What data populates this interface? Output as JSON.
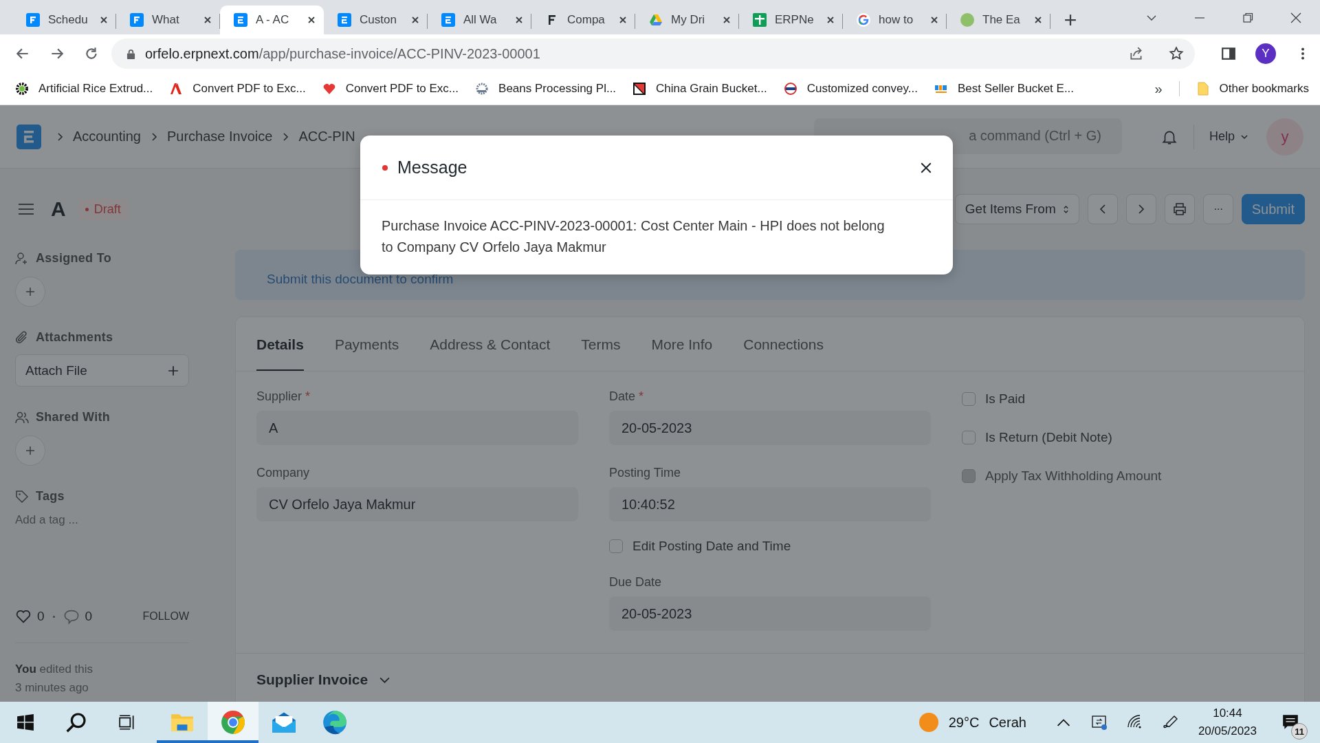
{
  "browser": {
    "tabs": [
      {
        "title": "Schedu",
        "kind": "frappe",
        "selected": false
      },
      {
        "title": "What",
        "kind": "frappe",
        "selected": false
      },
      {
        "title": "A - AC",
        "kind": "erpnext",
        "selected": true
      },
      {
        "title": "Custon",
        "kind": "erpnext",
        "selected": false
      },
      {
        "title": "All Wa",
        "kind": "erpnext",
        "selected": false
      },
      {
        "title": "Compa",
        "kind": "frappe-dark",
        "selected": false
      },
      {
        "title": "My Dri",
        "kind": "drive",
        "selected": false
      },
      {
        "title": "ERPNe",
        "kind": "sheets",
        "selected": false
      },
      {
        "title": "how to",
        "kind": "google",
        "selected": false
      },
      {
        "title": "The Ea",
        "kind": "circle",
        "selected": false
      }
    ],
    "address": {
      "host": "orfelo.erpnext.com",
      "path": "/app/purchase-invoice/ACC-PINV-2023-00001"
    },
    "profile": "Y",
    "bookmarks": [
      {
        "label": "Artificial Rice Extrud...",
        "kind": "gear"
      },
      {
        "label": "Convert PDF to Exc...",
        "kind": "adobe"
      },
      {
        "label": "Convert PDF to Exc...",
        "kind": "heart"
      },
      {
        "label": "Beans Processing Pl...",
        "kind": "cog"
      },
      {
        "label": "China Grain Bucket...",
        "kind": "flag"
      },
      {
        "label": "Customized convey...",
        "kind": "seal"
      },
      {
        "label": "Best Seller Bucket E...",
        "kind": "hic"
      }
    ],
    "overflow": "»",
    "other_bookmarks": "Other bookmarks"
  },
  "navbar": {
    "breadcrumbs": [
      "Accounting",
      "Purchase Invoice",
      "ACC-PIN"
    ],
    "search_placeholder": "a command (Ctrl + G)",
    "help": "Help",
    "avatar": "y"
  },
  "page_head": {
    "title": "A",
    "status": "Draft",
    "menu_button": "Get Items From",
    "more": "···",
    "primary": "Submit"
  },
  "sidebar": {
    "assigned_to": "Assigned To",
    "attachments": "Attachments",
    "attach_file": "Attach File",
    "shared_with": "Shared With",
    "tags": "Tags",
    "add_tag": "Add a tag ...",
    "likes": "0",
    "comments": "0",
    "follow": "FOLLOW",
    "activity_actor": "You",
    "activity_text": "edited this",
    "activity_time": "3 minutes ago"
  },
  "banner": "Submit this document to confirm",
  "form_tabs": [
    {
      "label": "Details",
      "selected": true
    },
    {
      "label": "Payments",
      "selected": false
    },
    {
      "label": "Address & Contact",
      "selected": false
    },
    {
      "label": "Terms",
      "selected": false
    },
    {
      "label": "More Info",
      "selected": false
    },
    {
      "label": "Connections",
      "selected": false
    }
  ],
  "columns": [
    {
      "items": [
        {
          "kind": "field",
          "label": "Supplier",
          "required_mark": "*",
          "value": "A"
        },
        {
          "kind": "field",
          "label": "Company",
          "value": "CV Orfelo Jaya Makmur"
        }
      ]
    },
    {
      "items": [
        {
          "kind": "field",
          "label": "Date",
          "required_mark": "*",
          "value": "20-05-2023"
        },
        {
          "kind": "field",
          "label": "Posting Time",
          "value": "10:40:52"
        },
        {
          "kind": "check",
          "label": "Edit Posting Date and Time",
          "checked": false,
          "disabled": false
        },
        {
          "kind": "field",
          "label": "Due Date",
          "value": "20-05-2023"
        }
      ]
    },
    {
      "items": [
        {
          "kind": "check",
          "label": "Is Paid",
          "checked": false,
          "disabled": false
        },
        {
          "kind": "check",
          "label": "Is Return (Debit Note)",
          "checked": false,
          "disabled": false
        },
        {
          "kind": "check",
          "label": "Apply Tax Withholding Amount",
          "checked": false,
          "disabled": true
        }
      ]
    }
  ],
  "section": "Supplier Invoice",
  "modal": {
    "title": "Message",
    "text": "Purchase Invoice ACC-PINV-2023-00001: Cost Center Main - HPI does not belong to Company CV Orfelo Jaya Makmur"
  },
  "taskbar": {
    "apps": [
      {
        "kind": "start",
        "running": false,
        "selected": false
      },
      {
        "kind": "search",
        "running": false,
        "selected": false
      },
      {
        "kind": "taskview",
        "running": false,
        "selected": false
      },
      {
        "kind": "explorer",
        "running": true,
        "selected": false
      },
      {
        "kind": "chrome",
        "running": true,
        "selected": true
      },
      {
        "kind": "mail",
        "running": false,
        "selected": false
      },
      {
        "kind": "edge",
        "running": false,
        "selected": false
      }
    ],
    "temperature": "29°C",
    "weather": "Cerah",
    "time": "10:44",
    "date": "20/05/2023",
    "notifications": "11"
  }
}
